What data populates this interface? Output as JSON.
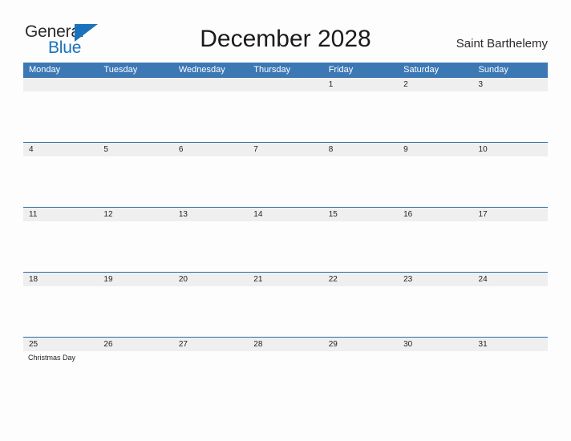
{
  "brand": {
    "line1": "General",
    "line2": "Blue",
    "flag_icon": "blue-triangle-flag-icon",
    "text_color": "#2b2b2b",
    "accent_color": "#1a72bd"
  },
  "header": {
    "title": "December 2028",
    "region": "Saint Barthelemy"
  },
  "theme": {
    "header_band": "#3c78b4",
    "row_rule": "#2a6ba8",
    "band_shade": "#efeff0",
    "page_background": "#fdfdfd"
  },
  "calendar": {
    "weekdays": [
      "Monday",
      "Tuesday",
      "Wednesday",
      "Thursday",
      "Friday",
      "Saturday",
      "Sunday"
    ],
    "weeks": [
      [
        {
          "date": ""
        },
        {
          "date": ""
        },
        {
          "date": ""
        },
        {
          "date": ""
        },
        {
          "date": "1"
        },
        {
          "date": "2"
        },
        {
          "date": "3"
        }
      ],
      [
        {
          "date": "4"
        },
        {
          "date": "5"
        },
        {
          "date": "6"
        },
        {
          "date": "7"
        },
        {
          "date": "8"
        },
        {
          "date": "9"
        },
        {
          "date": "10"
        }
      ],
      [
        {
          "date": "11"
        },
        {
          "date": "12"
        },
        {
          "date": "13"
        },
        {
          "date": "14"
        },
        {
          "date": "15"
        },
        {
          "date": "16"
        },
        {
          "date": "17"
        }
      ],
      [
        {
          "date": "18"
        },
        {
          "date": "19"
        },
        {
          "date": "20"
        },
        {
          "date": "21"
        },
        {
          "date": "22"
        },
        {
          "date": "23"
        },
        {
          "date": "24"
        }
      ],
      [
        {
          "date": "25",
          "holiday": "Christmas Day"
        },
        {
          "date": "26"
        },
        {
          "date": "27"
        },
        {
          "date": "28"
        },
        {
          "date": "29"
        },
        {
          "date": "30"
        },
        {
          "date": "31"
        }
      ]
    ]
  }
}
